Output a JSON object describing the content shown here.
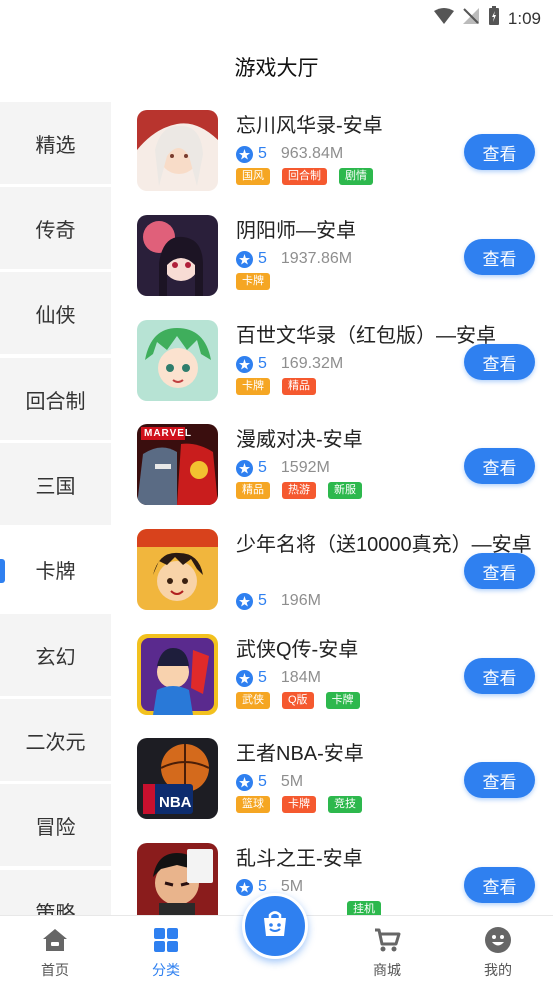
{
  "status_bar": {
    "time": "1:09"
  },
  "header": {
    "title": "游戏大厅"
  },
  "colors": {
    "accent": "#2f80f0",
    "sidebar_bg": "#f4f4f4"
  },
  "sidebar": {
    "items": [
      {
        "label": "精选",
        "active": false
      },
      {
        "label": "传奇",
        "active": false
      },
      {
        "label": "仙侠",
        "active": false
      },
      {
        "label": "回合制",
        "active": false
      },
      {
        "label": "三国",
        "active": false
      },
      {
        "label": "卡牌",
        "active": true
      },
      {
        "label": "玄幻",
        "active": false
      },
      {
        "label": "二次元",
        "active": false
      },
      {
        "label": "冒险",
        "active": false
      },
      {
        "label": "策略",
        "active": false
      }
    ]
  },
  "games": [
    {
      "name": "忘川风华录-安卓",
      "rating": "5",
      "size": "963.84M",
      "tags": [
        {
          "text": "国风",
          "color": "#f5a623"
        },
        {
          "text": "回合制",
          "color": "#f5592f"
        },
        {
          "text": "剧情",
          "color": "#2db84d"
        }
      ],
      "button": "查看"
    },
    {
      "name": "阴阳师—安卓",
      "rating": "5",
      "size": "1937.86M",
      "tags": [
        {
          "text": "卡牌",
          "color": "#f5a623"
        }
      ],
      "button": "查看"
    },
    {
      "name": "百世文华录（红包版）—安卓",
      "rating": "5",
      "size": "169.32M",
      "tags": [
        {
          "text": "卡牌",
          "color": "#f5a623"
        },
        {
          "text": "精品",
          "color": "#f5592f"
        }
      ],
      "button": "查看"
    },
    {
      "name": "漫威对决-安卓",
      "rating": "5",
      "size": "1592M",
      "tags": [
        {
          "text": "精品",
          "color": "#f5a623"
        },
        {
          "text": "热游",
          "color": "#f5592f"
        },
        {
          "text": "新服",
          "color": "#2db84d"
        }
      ],
      "button": "查看"
    },
    {
      "name": " 少年名将（送10000真充）—安卓",
      "rating": "5",
      "size": "196M",
      "tags": [],
      "button": "查看"
    },
    {
      "name": "武侠Q传-安卓",
      "rating": "5",
      "size": "184M",
      "tags": [
        {
          "text": "武侠",
          "color": "#f5a623"
        },
        {
          "text": "Q版",
          "color": "#f5592f"
        },
        {
          "text": "卡牌",
          "color": "#2db84d"
        }
      ],
      "button": "查看"
    },
    {
      "name": "王者NBA-安卓",
      "rating": "5",
      "size": "5M",
      "tags": [
        {
          "text": "篮球",
          "color": "#f5a623"
        },
        {
          "text": "卡牌",
          "color": "#f5592f"
        },
        {
          "text": "竞技",
          "color": "#2db84d"
        }
      ],
      "button": "查看"
    },
    {
      "name": "乱斗之王-安卓",
      "rating": "5",
      "size": "5M",
      "tags": [
        {
          "text": "挂机",
          "color": "#2db84d"
        }
      ],
      "button": "查看"
    }
  ],
  "bottom_nav": {
    "items": [
      {
        "label": "首页",
        "icon": "home-icon",
        "active": false
      },
      {
        "label": "分类",
        "icon": "category-icon",
        "active": true
      },
      {
        "label": "商城",
        "icon": "cart-icon",
        "active": false
      },
      {
        "label": "我的",
        "icon": "profile-icon",
        "active": false
      }
    ],
    "center_icon": "shopping-bag-icon"
  }
}
